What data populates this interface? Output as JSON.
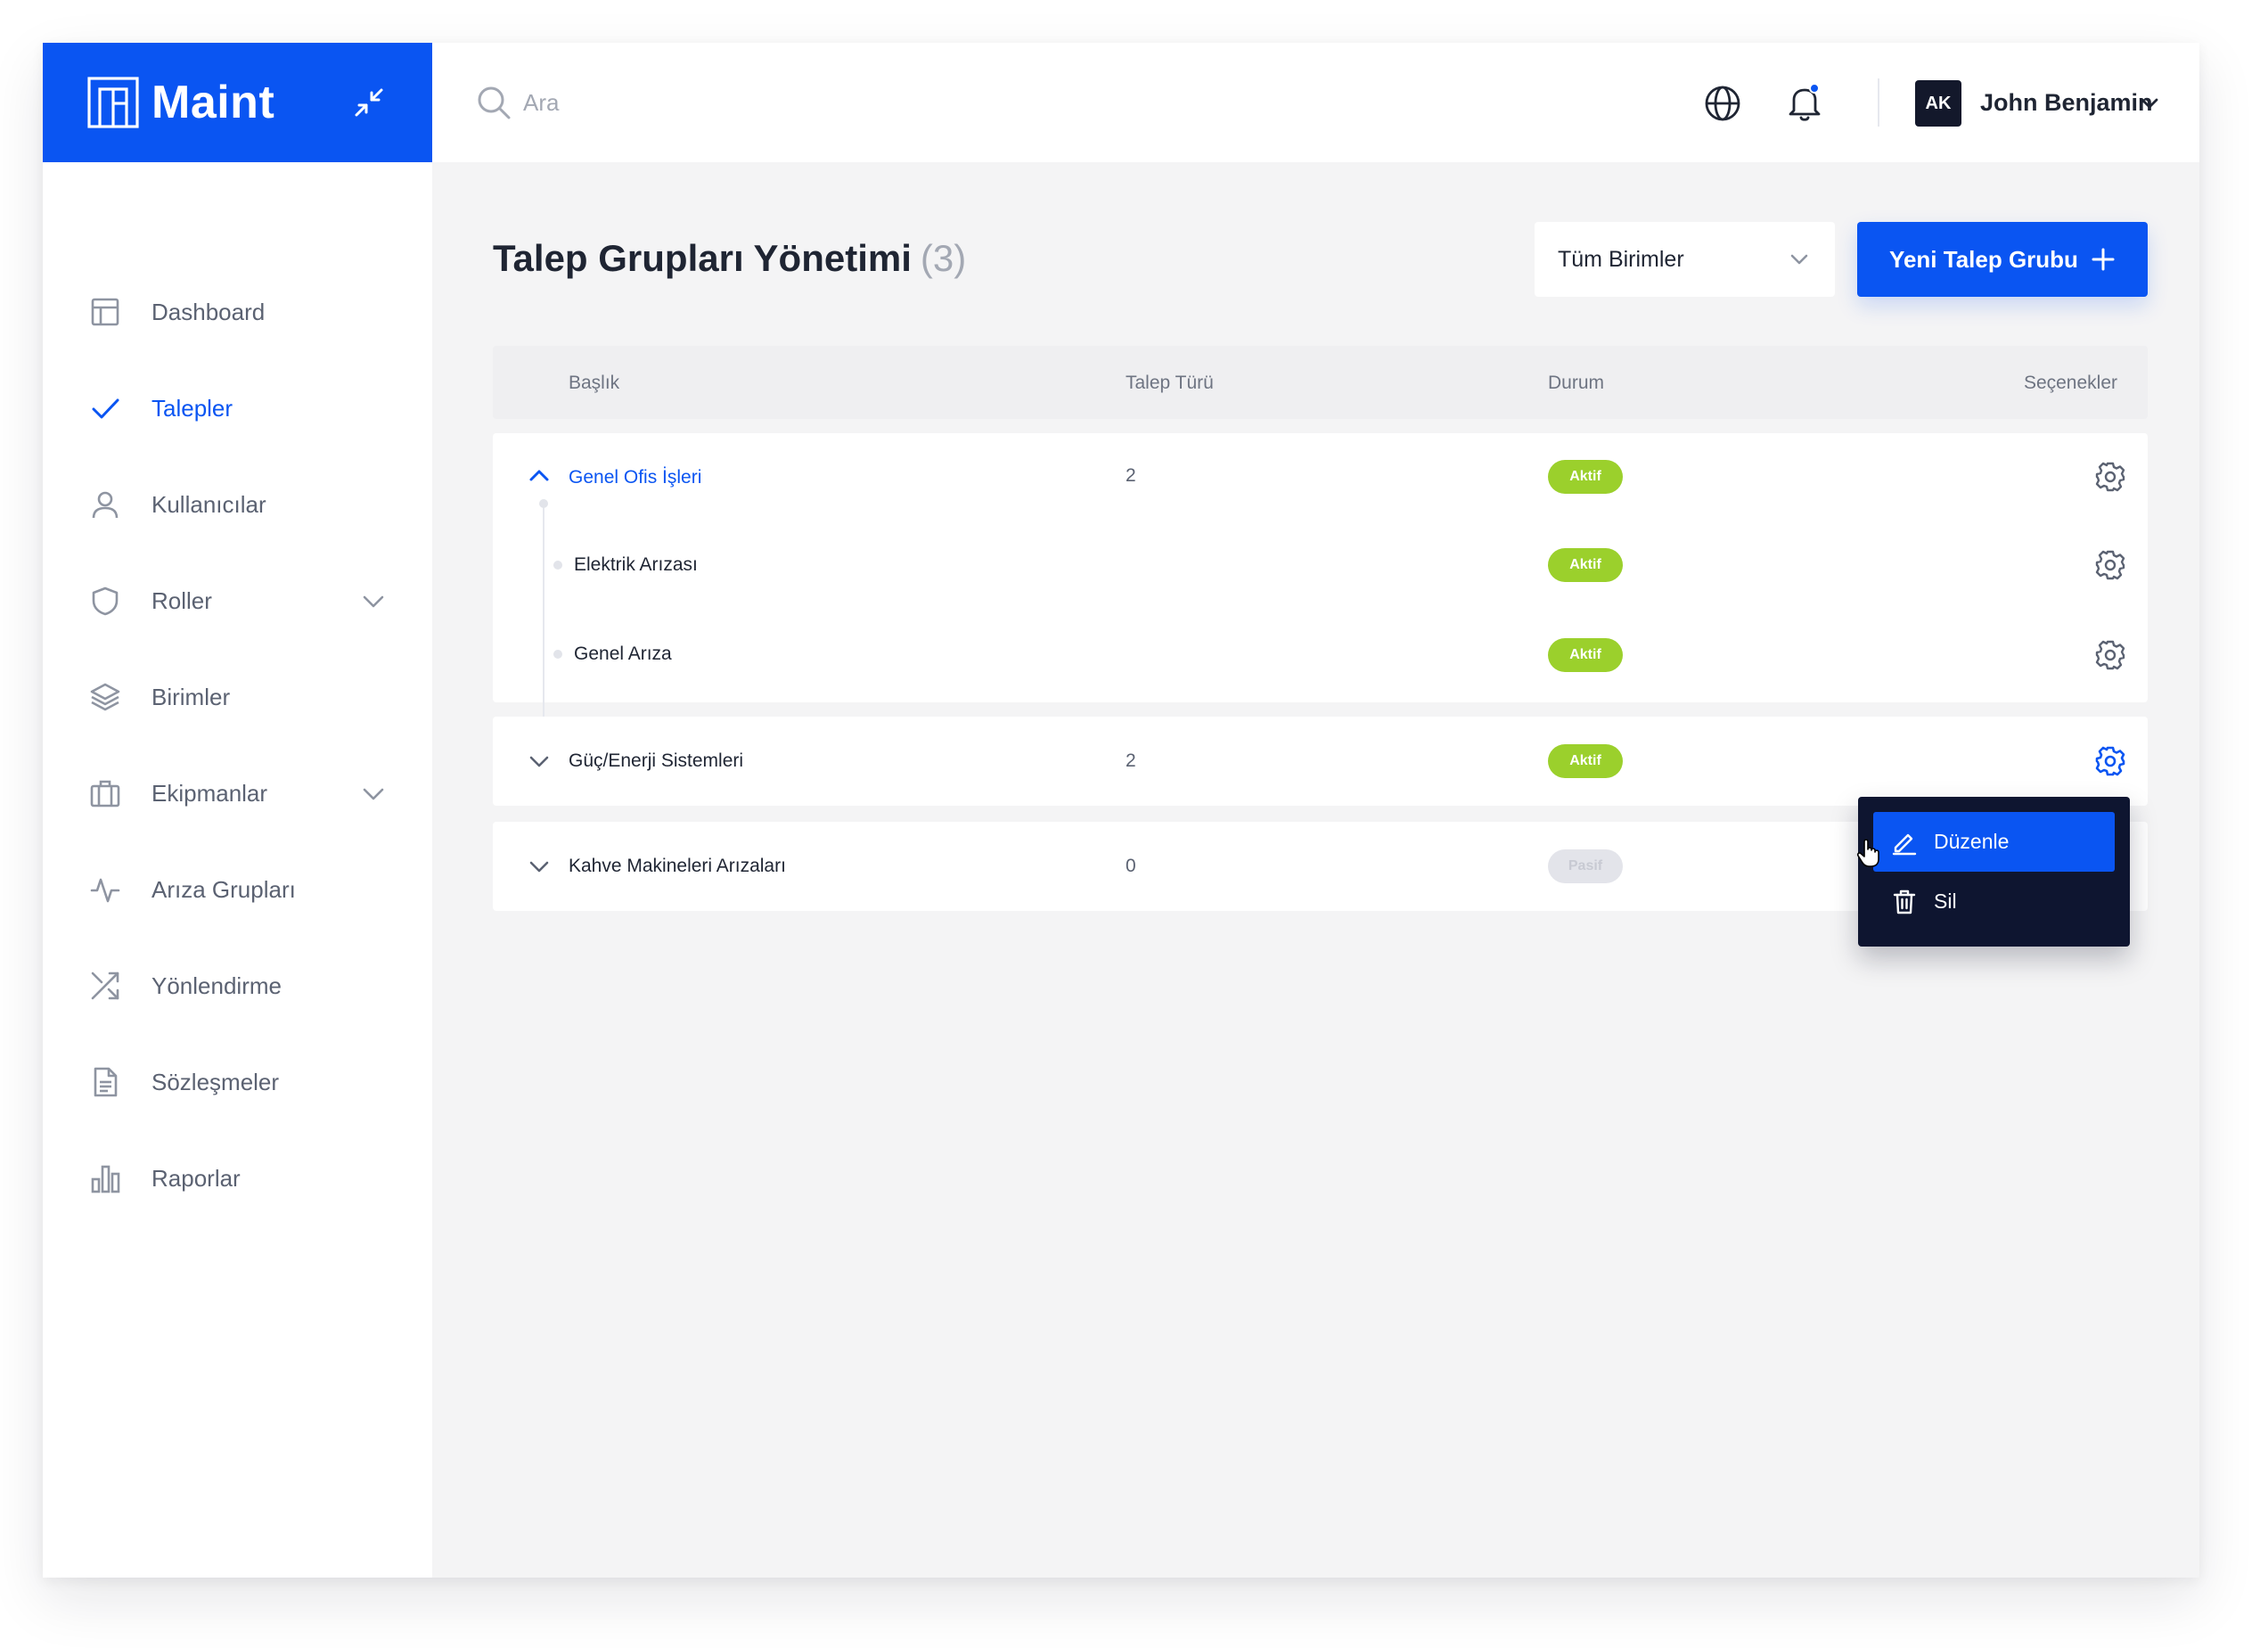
{
  "brand": {
    "name": "Maint"
  },
  "colors": {
    "primary": "#0a55f2",
    "active_badge": "#9bd02c",
    "menu_bg": "#0e1530",
    "sidebar_text": "#5b6272"
  },
  "sidebar": {
    "items": [
      {
        "label": "Dashboard",
        "icon": "layout-icon",
        "active": false
      },
      {
        "label": "Talepler",
        "icon": "check-icon",
        "active": true
      },
      {
        "label": "Kullanıcılar",
        "icon": "user-icon",
        "active": false
      },
      {
        "label": "Roller",
        "icon": "shield-icon",
        "active": false,
        "expandable": true
      },
      {
        "label": "Birimler",
        "icon": "layers-icon",
        "active": false
      },
      {
        "label": "Ekipmanlar",
        "icon": "briefcase-icon",
        "active": false,
        "expandable": true
      },
      {
        "label": "Arıza Grupları",
        "icon": "activity-icon",
        "active": false
      },
      {
        "label": "Yönlendirme",
        "icon": "shuffle-icon",
        "active": false
      },
      {
        "label": "Sözleşmeler",
        "icon": "file-icon",
        "active": false
      },
      {
        "label": "Raporlar",
        "icon": "bar-chart-icon",
        "active": false
      }
    ]
  },
  "topbar": {
    "search_placeholder": "Ara",
    "user": {
      "initials": "AK",
      "name": "John Benjamin"
    }
  },
  "page": {
    "title": "Talep Grupları Yönetimi",
    "count": "(3)",
    "unit_filter": "Tüm Birimler",
    "new_button": "Yeni Talep Grubu"
  },
  "table": {
    "headers": {
      "title": "Başlık",
      "type": "Talep Türü",
      "status": "Durum",
      "options": "Seçenekler"
    },
    "groups": [
      {
        "title": "Genel Ofis İşleri",
        "count": "2",
        "status": "Aktif",
        "expanded": true,
        "children": [
          {
            "title": "Elektrik Arızası",
            "status": "Aktif"
          },
          {
            "title": "Genel Arıza",
            "status": "Aktif"
          }
        ]
      },
      {
        "title": "Güç/Enerji Sistemleri",
        "count": "2",
        "status": "Aktif",
        "expanded": false
      },
      {
        "title": "Kahve Makineleri Arızaları",
        "count": "0",
        "status": "Pasif",
        "expanded": false
      }
    ]
  },
  "context_menu": {
    "items": [
      {
        "label": "Düzenle",
        "icon": "pencil-icon",
        "hovered": true
      },
      {
        "label": "Sil",
        "icon": "trash-icon",
        "hovered": false
      }
    ]
  }
}
